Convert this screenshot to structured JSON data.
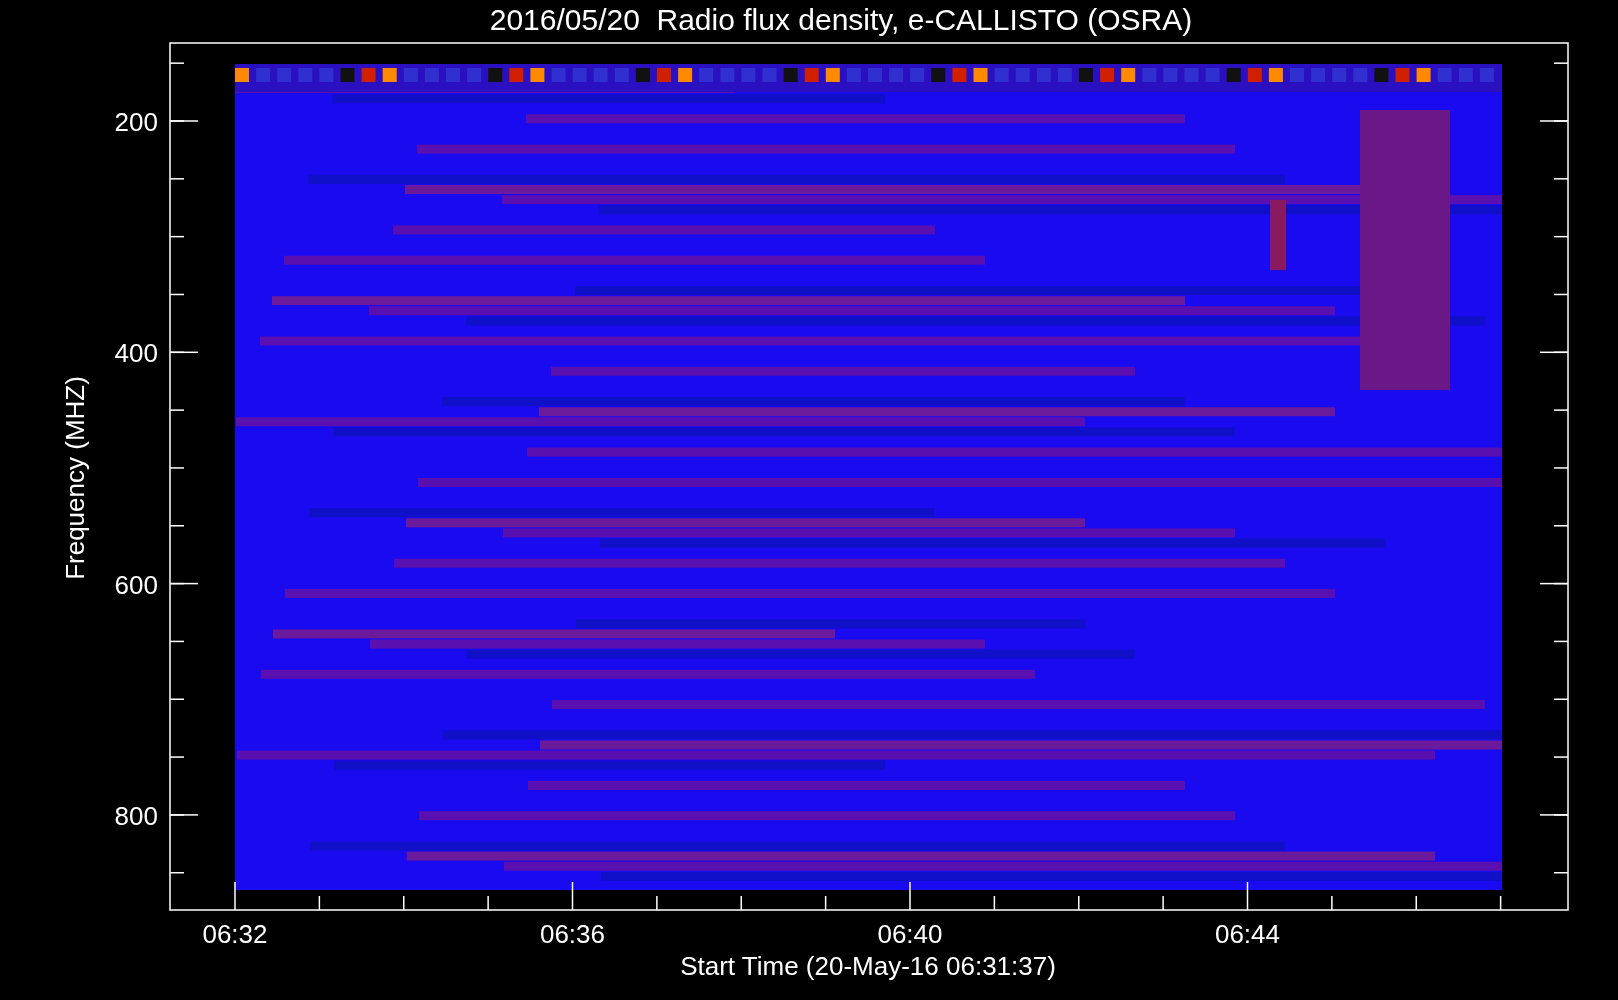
{
  "title": "2016/05/20  Radio flux density, e-CALLISTO (OSRA)",
  "y_axis": {
    "label": "Frequency (MHZ)",
    "ticks": [
      "200",
      "400",
      "600",
      "800"
    ]
  },
  "x_axis": {
    "label": "Start Time (20-May-16 06:31:37)",
    "ticks": [
      "06:32",
      "06:36",
      "06:40",
      "06:44"
    ]
  }
}
